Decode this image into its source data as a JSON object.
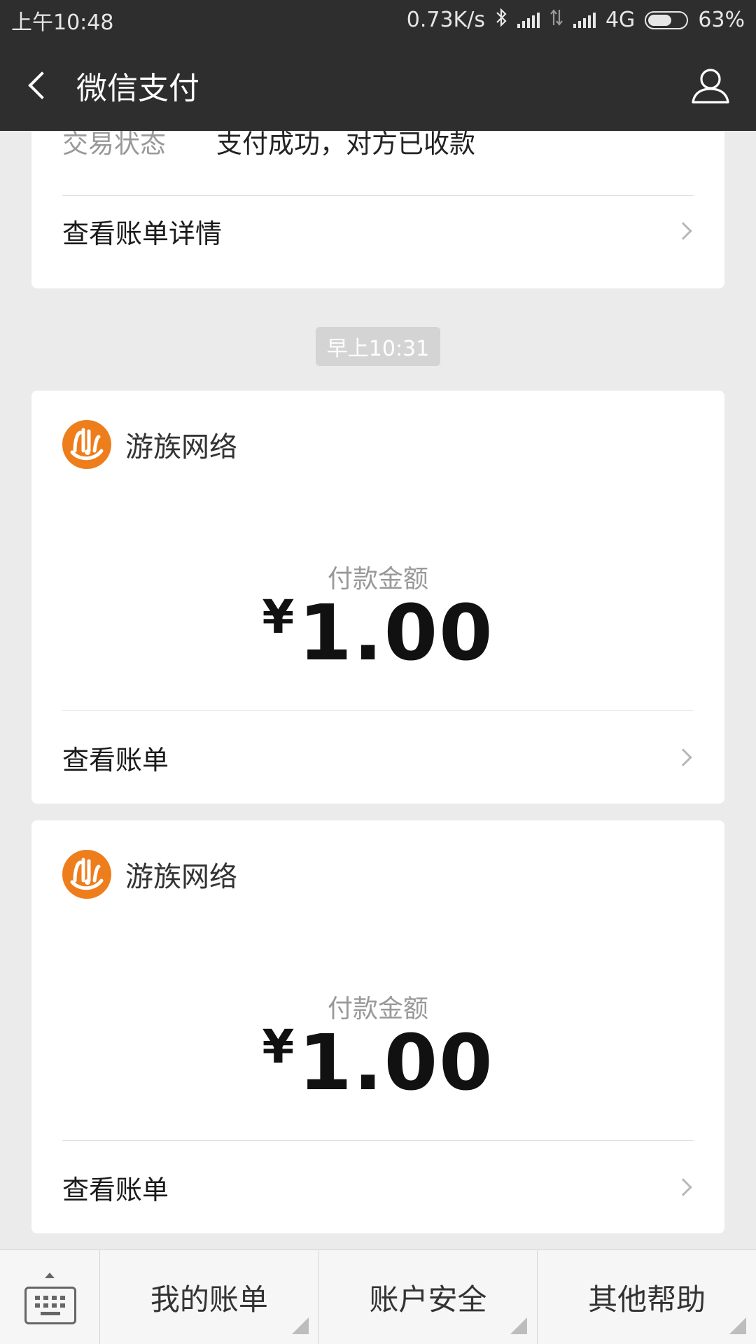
{
  "status_bar": {
    "time": "上午10:48",
    "net_speed": "0.73K/s",
    "network": "4G",
    "battery": "63%",
    "battery_level": 0.63
  },
  "header": {
    "title": "微信支付",
    "back_icon": "chevron-left-icon",
    "user_icon": "user-icon"
  },
  "top_card": {
    "status_label": "交易状态",
    "status_value": "支付成功，对方已收款",
    "link_label": "查看账单详情"
  },
  "time_badge": "早上10:31",
  "payments": [
    {
      "merchant": "游族网络",
      "amount_label": "付款金额",
      "currency": "¥",
      "amount": "1.00",
      "link_label": "查看账单"
    },
    {
      "merchant": "游族网络",
      "amount_label": "付款金额",
      "currency": "¥",
      "amount": "1.00",
      "link_label": "查看账单"
    }
  ],
  "bottom_bar": {
    "keyboard_icon": "keyboard-icon",
    "tabs": [
      "我的账单",
      "账户安全",
      "其他帮助"
    ]
  },
  "colors": {
    "header_bg": "#2e2e2e",
    "page_bg": "#ebebeb",
    "logo_orange": "#ee7d1b"
  }
}
